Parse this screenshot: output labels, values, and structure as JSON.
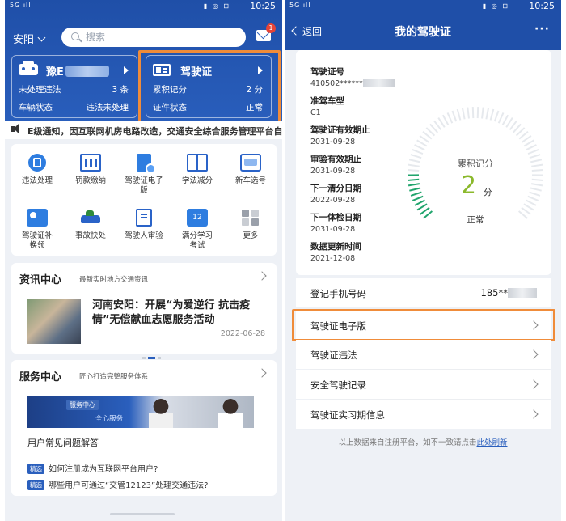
{
  "status_bar": {
    "signal": "5G ıll",
    "icons": "▮ ◎ ⊟",
    "battery": "▭",
    "time": "10:25"
  },
  "left": {
    "city": "安阳",
    "search": {
      "placeholder": "搜索"
    },
    "mail_badge": "1",
    "vehicle_card": {
      "plate_prefix": "豫E",
      "row1_label": "未处理违法",
      "row1_value": "3 条",
      "row2_label": "车辆状态",
      "row2_value": "违法未处理"
    },
    "license_card": {
      "title": "驾驶证",
      "row1_label": "累积记分",
      "row1_value": "2 分",
      "row2_label": "证件状态",
      "row2_value": "正常"
    },
    "marquee": "E级通知，因互联网机房电路改造，交通安全综合服务管理平台自",
    "services": [
      {
        "label": "违法处理",
        "icon": "ticket-icon"
      },
      {
        "label": "罚款缴纳",
        "icon": "receipt-icon"
      },
      {
        "label": "驾驶证电子版",
        "icon": "e-license-icon"
      },
      {
        "label": "学法减分",
        "icon": "book-icon"
      },
      {
        "label": "新车选号",
        "icon": "plate-icon"
      },
      {
        "label": "驾驶证补换领",
        "icon": "renew-icon"
      },
      {
        "label": "事故快处",
        "icon": "car-accident-icon"
      },
      {
        "label": "驾驶人审验",
        "icon": "review-icon"
      },
      {
        "label": "满分学习考试",
        "icon": "calendar-icon"
      },
      {
        "label": "更多",
        "icon": "grid-icon"
      }
    ],
    "news": {
      "title": "资讯中心",
      "subtitle": "最新实时地方交通资讯",
      "headline": "河南安阳：开展“为爱逆行 抗击疫情”无偿献血志愿服务活动",
      "date": "2022-06-28"
    },
    "service_center": {
      "title": "服务中心",
      "subtitle": "匠心打造完整服务体系",
      "banner_tag": "服务中心",
      "banner_text": "全心服务",
      "faq_title": "用户常见问题解答",
      "faq_tag": "精选",
      "faqs": [
        "如何注册成为互联网平台用户?",
        "哪些用户可通过“交管12123”处理交通违法?"
      ]
    }
  },
  "right": {
    "back": "返回",
    "title": "我的驾驶证",
    "more": "···",
    "fields": [
      {
        "key": "驾驶证号",
        "value": "410502******"
      },
      {
        "key": "准驾车型",
        "value": "C1"
      },
      {
        "key": "驾驶证有效期止",
        "value": "2031-09-28"
      },
      {
        "key": "审验有效期止",
        "value": "2031-09-28"
      },
      {
        "key": "下一清分日期",
        "value": "2022-09-28"
      },
      {
        "key": "下一体检日期",
        "value": "2031-09-28"
      },
      {
        "key": "数据更新时间",
        "value": "2021-12-08"
      }
    ],
    "gauge": {
      "label": "累积记分",
      "value": "2",
      "unit": "分",
      "status": "正常",
      "score": 2,
      "max": 12,
      "color_active": "#21a56d",
      "color_track": "#e6e9ed"
    },
    "phone": {
      "label": "登记手机号码",
      "value": "185**"
    },
    "menu": [
      "驾驶证电子版",
      "驾驶证违法",
      "安全驾驶记录",
      "驾驶证实习期信息"
    ],
    "footer": {
      "text": "以上数据来自注册平台，如不一致请点击",
      "link": "此处刷新"
    }
  },
  "colors": {
    "brand": "#1f4fa8",
    "highlight": "#f08c3a",
    "score": "#8bb92c"
  }
}
